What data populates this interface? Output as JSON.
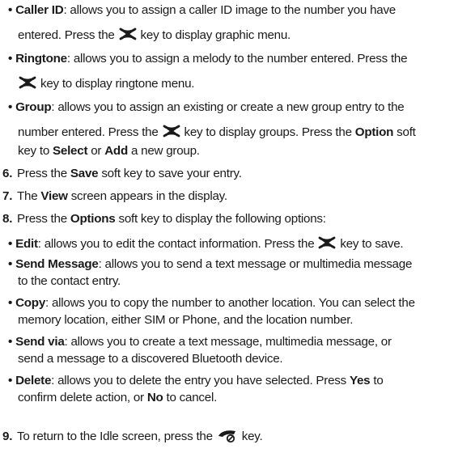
{
  "bullets_top": [
    {
      "term": "Caller ID",
      "line1": ": allows you to assign a caller ID image to the number you have",
      "line2_pre": "entered. Press the ",
      "line2_post": " key to display graphic menu."
    },
    {
      "term": "Ringtone",
      "line1": ": allows you to assign a melody to the number entered. Press the",
      "line2_post": " key to display ringtone menu."
    },
    {
      "term": "Group",
      "line1": ": allows you to assign an existing or create a new group entry to the",
      "line2_pre": "number entered. Press the ",
      "line2_post": " key to display groups. Press the ",
      "line2_bold": "Option",
      "line2_end": " soft",
      "line3_pre": "key to ",
      "line3_b1": "Select",
      "line3_mid": " or ",
      "line3_b2": "Add",
      "line3_post": " a new group."
    }
  ],
  "steps": {
    "s6": {
      "num": "6.",
      "pre": "Press the ",
      "b": "Save",
      "post": " soft key to save your entry."
    },
    "s7": {
      "num": "7.",
      "pre": "The ",
      "b": "View",
      "post": " screen appears in the display."
    },
    "s8": {
      "num": "8.",
      "pre": "Press the ",
      "b": "Options",
      "post": " soft key to display the following options:"
    },
    "s9": {
      "num": "9.",
      "pre": "To return to the Idle screen, press the ",
      "post": " key."
    }
  },
  "options": {
    "edit": {
      "term": "Edit",
      "pre": ": allows you to edit the contact information. Press the ",
      "post": " key to save."
    },
    "send_message": {
      "term": "Send Message",
      "line1": ": allows you to send a text message or multimedia message",
      "line2": "to the contact entry."
    },
    "copy": {
      "term": "Copy",
      "line1": ": allows you to copy the number to another location. You can select the",
      "line2": "memory location, either SIM or Phone, and the location number."
    },
    "send_via": {
      "term": "Send via",
      "line1": ": allows you to create a text message, multimedia message, or",
      "line2": "send a message to a discovered Bluetooth device."
    },
    "delete": {
      "term": "Delete",
      "line1": ": allows you to delete the entry you have selected. Press ",
      "b1": "Yes",
      "line1_post": " to",
      "line2_pre": "confirm delete action, or ",
      "b2": "No",
      "line2_post": " to cancel."
    }
  },
  "bullet_char": "•",
  "icons": {
    "nav": "nav-key-icon",
    "end": "end-key-icon"
  }
}
